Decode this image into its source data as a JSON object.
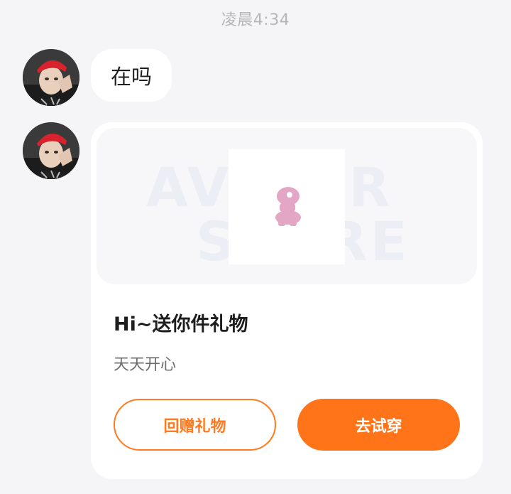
{
  "chat": {
    "timestamp": "凌晨4:34",
    "messages": [
      {
        "type": "text",
        "text": "在吗"
      }
    ],
    "gift_card": {
      "banner_watermark_text": "AVATAR STORE",
      "title": "Hi~送你件礼物",
      "message": "天天开心",
      "return_gift_label": "回赠礼物",
      "try_on_label": "去试穿"
    }
  },
  "colors": {
    "page_background": "#f5f5f7",
    "accent_orange": "#ff7419",
    "card_background": "#ffffff"
  },
  "icons": {
    "avatar": "user-avatar-photo",
    "gift_preview": "pink-figure-gift-icon"
  }
}
